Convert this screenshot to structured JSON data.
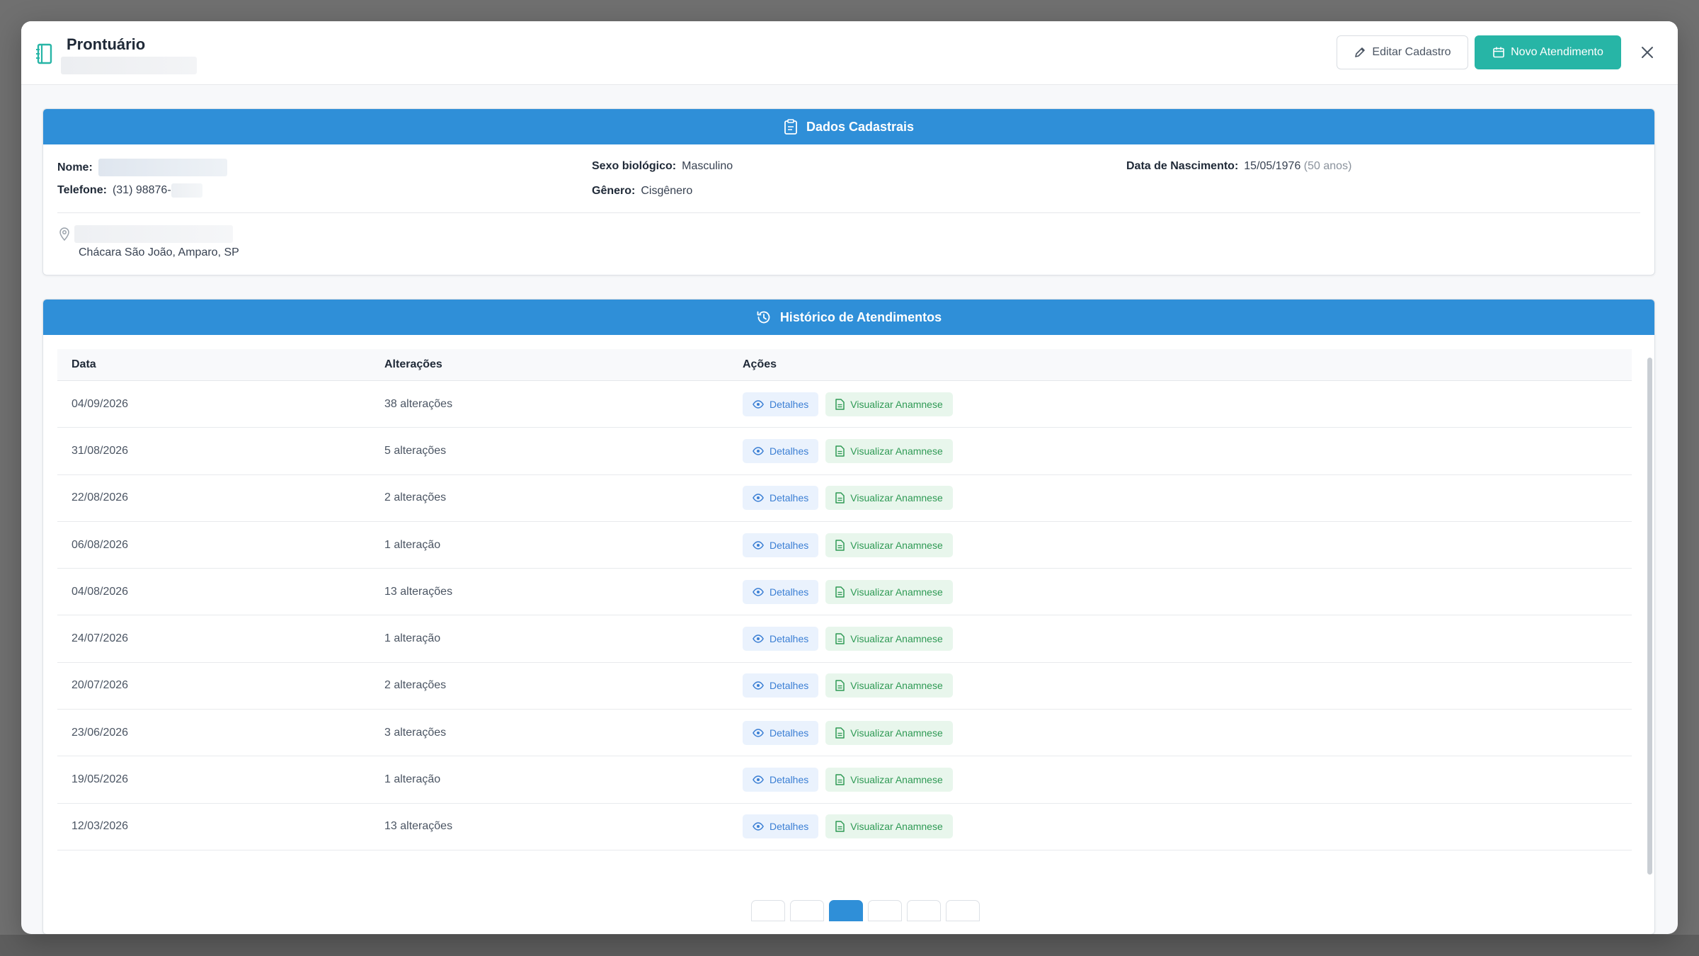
{
  "header": {
    "title": "Prontuário",
    "edit_label": "Editar Cadastro",
    "new_label": "Novo Atendimento"
  },
  "dados": {
    "title": "Dados Cadastrais",
    "nome_label": "Nome:",
    "telefone_label": "Telefone:",
    "telefone_value": "(31) 98876-",
    "sexo_label": "Sexo biológico:",
    "sexo_value": "Masculino",
    "genero_label": "Gênero:",
    "genero_value": "Cisgênero",
    "nascimento_label": "Data de Nascimento:",
    "nascimento_value": "15/05/1976",
    "idade": "(50 anos)",
    "endereco_cidade": "Chácara São João, Amparo, SP"
  },
  "historico": {
    "title": "Histórico de Atendimentos",
    "columns": [
      "Data",
      "Alterações",
      "Ações"
    ],
    "action_details": "Detalhes",
    "action_anamnese": "Visualizar Anamnese",
    "rows": [
      {
        "data": "04/09/2026",
        "alteracoes": "38 alterações"
      },
      {
        "data": "31/08/2026",
        "alteracoes": "5 alterações"
      },
      {
        "data": "22/08/2026",
        "alteracoes": "2 alterações"
      },
      {
        "data": "06/08/2026",
        "alteracoes": "1 alteração"
      },
      {
        "data": "04/08/2026",
        "alteracoes": "13 alterações"
      },
      {
        "data": "24/07/2026",
        "alteracoes": "1 alteração"
      },
      {
        "data": "20/07/2026",
        "alteracoes": "2 alterações"
      },
      {
        "data": "23/06/2026",
        "alteracoes": "3 alterações"
      },
      {
        "data": "19/05/2026",
        "alteracoes": "1 alteração"
      },
      {
        "data": "12/03/2026",
        "alteracoes": "13 alterações"
      }
    ]
  },
  "icons": {
    "header": "notebook-icon",
    "edit": "pencil-icon",
    "new": "calendar-plus-icon",
    "close": "close-icon",
    "dados": "clipboard-icon",
    "historico": "history-icon",
    "address": "map-pin-icon",
    "details": "eye-icon",
    "anamnese": "file-text-icon"
  },
  "colors": {
    "accent_blue": "#2f8fd8",
    "accent_teal": "#27b5a6",
    "details_bg": "#eaf2fd",
    "anamnese_bg": "#e8f6ec"
  }
}
